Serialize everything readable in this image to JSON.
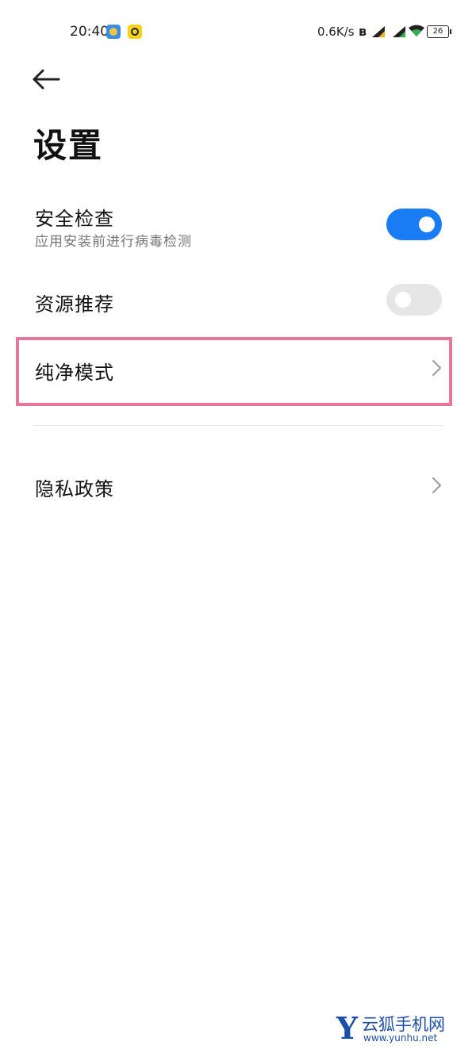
{
  "status_bar": {
    "time": "20:40",
    "network_speed": "0.6K/s",
    "battery": "26",
    "icons": [
      "app-notification-icon",
      "app-notification-icon",
      "bluetooth-icon",
      "signal-icon",
      "signal-icon",
      "wifi-icon",
      "battery-icon"
    ]
  },
  "header": {
    "back_icon": "arrow-left-icon",
    "title": "设置"
  },
  "settings": {
    "security_check": {
      "title": "安全检查",
      "subtitle": "应用安装前进行病毒检测",
      "enabled": true
    },
    "resource_recommend": {
      "title": "资源推荐",
      "enabled": false
    },
    "pure_mode": {
      "title": "纯净模式",
      "chevron": "chevron-right-icon"
    },
    "privacy_policy": {
      "title": "隐私政策",
      "chevron": "chevron-right-icon"
    }
  },
  "colors": {
    "toggle_on": "#1a7cf5",
    "toggle_off": "#e6e6e6",
    "highlight_border": "#e8759a"
  },
  "watermark": {
    "logo_letter": "Y",
    "name": "云狐手机网",
    "url": "www.yunhu.net"
  }
}
